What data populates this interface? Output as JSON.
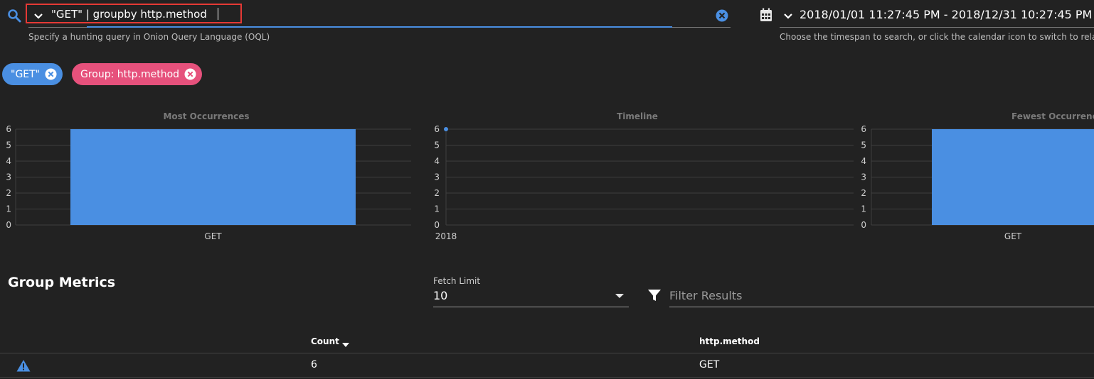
{
  "search": {
    "query": "\"GET\" | groupby http.method",
    "hint": "Specify a hunting query in Onion Query Language (OQL)"
  },
  "daterange": {
    "value": "2018/01/01 11:27:45 PM - 2018/12/31 10:27:45 PM",
    "hint": "Choose the timespan to search, or click the calendar icon to switch to relative time"
  },
  "chips": [
    {
      "label": "\"GET\"",
      "color": "#4a8fe2"
    },
    {
      "label": "Group: http.method",
      "color": "#e6517c"
    }
  ],
  "charts": {
    "most": {
      "title": "Most Occurrences"
    },
    "timeline": {
      "title": "Timeline"
    },
    "fewest": {
      "title": "Fewest Occurrences"
    }
  },
  "chart_data": [
    {
      "type": "bar",
      "title": "Most Occurrences",
      "categories": [
        "GET"
      ],
      "values": [
        6
      ],
      "ylim": [
        0,
        6
      ],
      "yticks": [
        "0",
        "1",
        "2",
        "3",
        "4",
        "5",
        "6"
      ],
      "color": "#4a8fe2",
      "grid": true
    },
    {
      "type": "line",
      "title": "Timeline",
      "x": [
        "2018"
      ],
      "values": [
        6
      ],
      "ylim": [
        0,
        6
      ],
      "yticks": [
        "0",
        "1",
        "2",
        "3",
        "4",
        "5",
        "6"
      ],
      "color": "#4a8fe2",
      "grid": true
    },
    {
      "type": "bar",
      "title": "Fewest Occurrences",
      "categories": [
        "GET"
      ],
      "values": [
        6
      ],
      "ylim": [
        0,
        6
      ],
      "yticks": [
        "0",
        "1",
        "2",
        "3",
        "4",
        "5",
        "6"
      ],
      "color": "#4a8fe2",
      "grid": true
    }
  ],
  "metrics": {
    "title": "Group Metrics",
    "fetch_limit_label": "Fetch Limit",
    "fetch_limit_value": "10",
    "filter_placeholder": "Filter Results",
    "columns": [
      "Count",
      "http.method"
    ],
    "rows": [
      {
        "count": "6",
        "method": "GET"
      }
    ]
  }
}
